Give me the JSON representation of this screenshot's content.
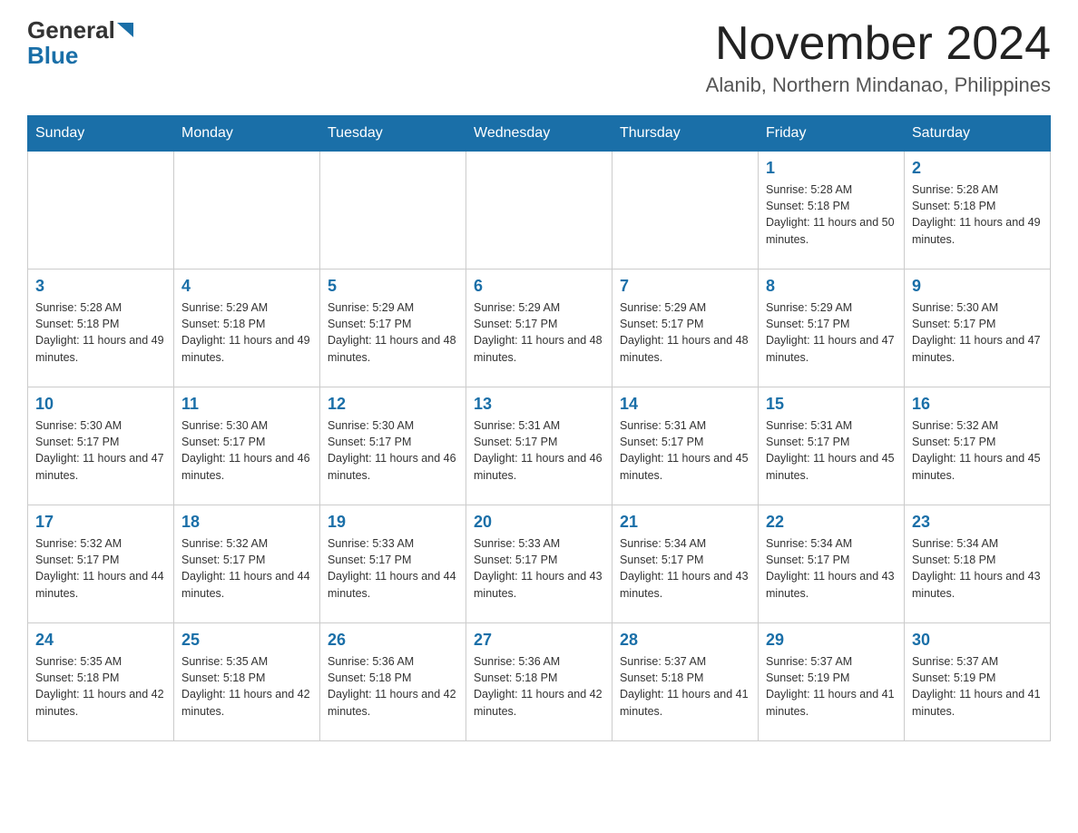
{
  "header": {
    "logo_general": "General",
    "logo_blue": "Blue",
    "month_title": "November 2024",
    "location": "Alanib, Northern Mindanao, Philippines"
  },
  "days_of_week": [
    "Sunday",
    "Monday",
    "Tuesday",
    "Wednesday",
    "Thursday",
    "Friday",
    "Saturday"
  ],
  "weeks": [
    [
      {
        "day": "",
        "info": ""
      },
      {
        "day": "",
        "info": ""
      },
      {
        "day": "",
        "info": ""
      },
      {
        "day": "",
        "info": ""
      },
      {
        "day": "",
        "info": ""
      },
      {
        "day": "1",
        "info": "Sunrise: 5:28 AM\nSunset: 5:18 PM\nDaylight: 11 hours and 50 minutes."
      },
      {
        "day": "2",
        "info": "Sunrise: 5:28 AM\nSunset: 5:18 PM\nDaylight: 11 hours and 49 minutes."
      }
    ],
    [
      {
        "day": "3",
        "info": "Sunrise: 5:28 AM\nSunset: 5:18 PM\nDaylight: 11 hours and 49 minutes."
      },
      {
        "day": "4",
        "info": "Sunrise: 5:29 AM\nSunset: 5:18 PM\nDaylight: 11 hours and 49 minutes."
      },
      {
        "day": "5",
        "info": "Sunrise: 5:29 AM\nSunset: 5:17 PM\nDaylight: 11 hours and 48 minutes."
      },
      {
        "day": "6",
        "info": "Sunrise: 5:29 AM\nSunset: 5:17 PM\nDaylight: 11 hours and 48 minutes."
      },
      {
        "day": "7",
        "info": "Sunrise: 5:29 AM\nSunset: 5:17 PM\nDaylight: 11 hours and 48 minutes."
      },
      {
        "day": "8",
        "info": "Sunrise: 5:29 AM\nSunset: 5:17 PM\nDaylight: 11 hours and 47 minutes."
      },
      {
        "day": "9",
        "info": "Sunrise: 5:30 AM\nSunset: 5:17 PM\nDaylight: 11 hours and 47 minutes."
      }
    ],
    [
      {
        "day": "10",
        "info": "Sunrise: 5:30 AM\nSunset: 5:17 PM\nDaylight: 11 hours and 47 minutes."
      },
      {
        "day": "11",
        "info": "Sunrise: 5:30 AM\nSunset: 5:17 PM\nDaylight: 11 hours and 46 minutes."
      },
      {
        "day": "12",
        "info": "Sunrise: 5:30 AM\nSunset: 5:17 PM\nDaylight: 11 hours and 46 minutes."
      },
      {
        "day": "13",
        "info": "Sunrise: 5:31 AM\nSunset: 5:17 PM\nDaylight: 11 hours and 46 minutes."
      },
      {
        "day": "14",
        "info": "Sunrise: 5:31 AM\nSunset: 5:17 PM\nDaylight: 11 hours and 45 minutes."
      },
      {
        "day": "15",
        "info": "Sunrise: 5:31 AM\nSunset: 5:17 PM\nDaylight: 11 hours and 45 minutes."
      },
      {
        "day": "16",
        "info": "Sunrise: 5:32 AM\nSunset: 5:17 PM\nDaylight: 11 hours and 45 minutes."
      }
    ],
    [
      {
        "day": "17",
        "info": "Sunrise: 5:32 AM\nSunset: 5:17 PM\nDaylight: 11 hours and 44 minutes."
      },
      {
        "day": "18",
        "info": "Sunrise: 5:32 AM\nSunset: 5:17 PM\nDaylight: 11 hours and 44 minutes."
      },
      {
        "day": "19",
        "info": "Sunrise: 5:33 AM\nSunset: 5:17 PM\nDaylight: 11 hours and 44 minutes."
      },
      {
        "day": "20",
        "info": "Sunrise: 5:33 AM\nSunset: 5:17 PM\nDaylight: 11 hours and 43 minutes."
      },
      {
        "day": "21",
        "info": "Sunrise: 5:34 AM\nSunset: 5:17 PM\nDaylight: 11 hours and 43 minutes."
      },
      {
        "day": "22",
        "info": "Sunrise: 5:34 AM\nSunset: 5:17 PM\nDaylight: 11 hours and 43 minutes."
      },
      {
        "day": "23",
        "info": "Sunrise: 5:34 AM\nSunset: 5:18 PM\nDaylight: 11 hours and 43 minutes."
      }
    ],
    [
      {
        "day": "24",
        "info": "Sunrise: 5:35 AM\nSunset: 5:18 PM\nDaylight: 11 hours and 42 minutes."
      },
      {
        "day": "25",
        "info": "Sunrise: 5:35 AM\nSunset: 5:18 PM\nDaylight: 11 hours and 42 minutes."
      },
      {
        "day": "26",
        "info": "Sunrise: 5:36 AM\nSunset: 5:18 PM\nDaylight: 11 hours and 42 minutes."
      },
      {
        "day": "27",
        "info": "Sunrise: 5:36 AM\nSunset: 5:18 PM\nDaylight: 11 hours and 42 minutes."
      },
      {
        "day": "28",
        "info": "Sunrise: 5:37 AM\nSunset: 5:18 PM\nDaylight: 11 hours and 41 minutes."
      },
      {
        "day": "29",
        "info": "Sunrise: 5:37 AM\nSunset: 5:19 PM\nDaylight: 11 hours and 41 minutes."
      },
      {
        "day": "30",
        "info": "Sunrise: 5:37 AM\nSunset: 5:19 PM\nDaylight: 11 hours and 41 minutes."
      }
    ]
  ]
}
